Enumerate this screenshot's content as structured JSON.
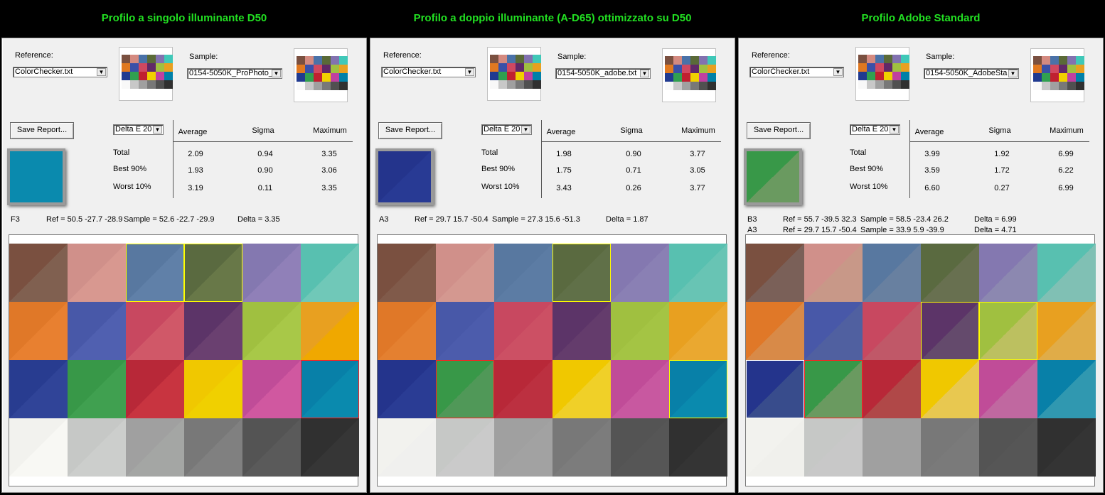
{
  "titles": [
    "Profilo a singolo illuminante D50",
    "Profilo a doppio illuminante (A-D65) ottimizzato su D50",
    "Profilo Adobe Standard"
  ],
  "thumb_colors": [
    "#7a5040",
    "#d48a80",
    "#4a72a8",
    "#5a6a38",
    "#8272b0",
    "#40c8b8",
    "#e07820",
    "#3a50a8",
    "#d04860",
    "#602868",
    "#a0c040",
    "#e8a020",
    "#203a90",
    "#30a050",
    "#c02030",
    "#f0d000",
    "#c040a0",
    "#0080a8",
    "#f8f8f8",
    "#c8c8c8",
    "#a0a0a0",
    "#787878",
    "#505050",
    "#303030"
  ],
  "panels": [
    {
      "reference_label": "Reference:",
      "reference_value": "ColorChecker.txt",
      "sample_label": "Sample:",
      "sample_value": "0154-5050K_ProPhoto_",
      "save_button": "Save Report...",
      "metric_value": "Delta E 20",
      "headers": {
        "average": "Average",
        "sigma": "Sigma",
        "maximum": "Maximum"
      },
      "rows": [
        {
          "label": "Total",
          "average": "2.09",
          "sigma": "0.94",
          "maximum": "3.35"
        },
        {
          "label": "Best 90%",
          "average": "1.93",
          "sigma": "0.90",
          "maximum": "3.06"
        },
        {
          "label": "Worst 10%",
          "average": "3.19",
          "sigma": "0.11",
          "maximum": "3.35"
        }
      ],
      "swatch_colors": [
        "#0a8aae",
        "#0a8aae"
      ],
      "details": [
        {
          "patch": "F3",
          "ref": "Ref =  50.5 -27.7 -28.9",
          "sample": "Sample =  52.6 -22.7 -29.9",
          "delta": "Delta =  3.35"
        }
      ],
      "cells": [
        {
          "ref": "#7a5040",
          "smp": "#806050",
          "mark": ""
        },
        {
          "ref": "#d0908a",
          "smp": "#d89890",
          "mark": ""
        },
        {
          "ref": "#5878a0",
          "smp": "#6080a8",
          "mark": "y"
        },
        {
          "ref": "#5a6a40",
          "smp": "#687848",
          "mark": "y"
        },
        {
          "ref": "#8478b0",
          "smp": "#9080b8",
          "mark": ""
        },
        {
          "ref": "#58c0b0",
          "smp": "#70c8b8",
          "mark": ""
        },
        {
          "ref": "#e07828",
          "smp": "#e88030",
          "mark": ""
        },
        {
          "ref": "#4858a8",
          "smp": "#5060b0",
          "mark": ""
        },
        {
          "ref": "#c84860",
          "smp": "#d05868",
          "mark": ""
        },
        {
          "ref": "#5c3468",
          "smp": "#6a4070",
          "mark": ""
        },
        {
          "ref": "#a0c040",
          "smp": "#a8c848",
          "mark": ""
        },
        {
          "ref": "#e8a020",
          "smp": "#f0a800",
          "mark": ""
        },
        {
          "ref": "#283c90",
          "smp": "#304498",
          "mark": ""
        },
        {
          "ref": "#389848",
          "smp": "#40a050",
          "mark": ""
        },
        {
          "ref": "#b82838",
          "smp": "#c83440",
          "mark": ""
        },
        {
          "ref": "#f0c800",
          "smp": "#f0d000",
          "mark": ""
        },
        {
          "ref": "#c04c98",
          "smp": "#d058a0",
          "mark": ""
        },
        {
          "ref": "#0880a8",
          "smp": "#0a8aae",
          "mark": "r"
        },
        {
          "ref": "#f2f2ee",
          "smp": "#f8f8f4",
          "mark": ""
        },
        {
          "ref": "#c6c8c6",
          "smp": "#cccecc",
          "mark": ""
        },
        {
          "ref": "#a0a0a0",
          "smp": "#a4a6a4",
          "mark": ""
        },
        {
          "ref": "#787878",
          "smp": "#808080",
          "mark": ""
        },
        {
          "ref": "#545454",
          "smp": "#5a5a5a",
          "mark": ""
        },
        {
          "ref": "#303030",
          "smp": "#363636",
          "mark": ""
        }
      ]
    },
    {
      "reference_label": "Reference:",
      "reference_value": "ColorChecker.txt",
      "sample_label": "Sample:",
      "sample_value": "0154-5050K_adobe.txt",
      "save_button": "Save Report...",
      "metric_value": "Delta E 20",
      "headers": {
        "average": "Average",
        "sigma": "Sigma",
        "maximum": "Maximum"
      },
      "rows": [
        {
          "label": "Total",
          "average": "1.98",
          "sigma": "0.90",
          "maximum": "3.77"
        },
        {
          "label": "Best 90%",
          "average": "1.75",
          "sigma": "0.71",
          "maximum": "3.05"
        },
        {
          "label": "Worst 10%",
          "average": "3.43",
          "sigma": "0.26",
          "maximum": "3.77"
        }
      ],
      "swatch_colors": [
        "#24348c",
        "#283a94"
      ],
      "details": [
        {
          "patch": "A3",
          "ref": "Ref =  29.7  15.7 -50.4",
          "sample": "Sample =  27.3  15.6 -51.3",
          "delta": "Delta =  1.87"
        }
      ],
      "cells": [
        {
          "ref": "#7a5040",
          "smp": "#805a4a",
          "mark": ""
        },
        {
          "ref": "#d0908a",
          "smp": "#d49890",
          "mark": ""
        },
        {
          "ref": "#5878a0",
          "smp": "#5c7ca4",
          "mark": ""
        },
        {
          "ref": "#5a6a40",
          "smp": "#607048",
          "mark": "y"
        },
        {
          "ref": "#8478b0",
          "smp": "#8a80b4",
          "mark": ""
        },
        {
          "ref": "#58c0b0",
          "smp": "#68c4b4",
          "mark": ""
        },
        {
          "ref": "#e07828",
          "smp": "#e48030",
          "mark": ""
        },
        {
          "ref": "#4858a8",
          "smp": "#4c5cac",
          "mark": ""
        },
        {
          "ref": "#c84860",
          "smp": "#cc5064",
          "mark": ""
        },
        {
          "ref": "#5c3468",
          "smp": "#643c6c",
          "mark": ""
        },
        {
          "ref": "#a0c040",
          "smp": "#a4c444",
          "mark": ""
        },
        {
          "ref": "#e8a020",
          "smp": "#eaa830",
          "mark": ""
        },
        {
          "ref": "#24348c",
          "smp": "#2a3c94",
          "mark": ""
        },
        {
          "ref": "#389848",
          "smp": "#509858",
          "mark": "r"
        },
        {
          "ref": "#b82838",
          "smp": "#bc3040",
          "mark": ""
        },
        {
          "ref": "#f0c800",
          "smp": "#f0d028",
          "mark": ""
        },
        {
          "ref": "#c04c98",
          "smp": "#c858a0",
          "mark": ""
        },
        {
          "ref": "#0880a8",
          "smp": "#0a8aae",
          "mark": "y"
        },
        {
          "ref": "#f2f2ee",
          "smp": "#f0f0ee",
          "mark": ""
        },
        {
          "ref": "#c6c8c6",
          "smp": "#cacaca",
          "mark": ""
        },
        {
          "ref": "#a0a0a0",
          "smp": "#a2a2a2",
          "mark": ""
        },
        {
          "ref": "#787878",
          "smp": "#7c7c7c",
          "mark": ""
        },
        {
          "ref": "#545454",
          "smp": "#565656",
          "mark": ""
        },
        {
          "ref": "#303030",
          "smp": "#343434",
          "mark": ""
        }
      ]
    },
    {
      "reference_label": "Reference:",
      "reference_value": "ColorChecker.txt",
      "sample_label": "Sample:",
      "sample_value": "0154-5050K_AdobeSta",
      "save_button": "Save Report...",
      "metric_value": "Delta E 20",
      "headers": {
        "average": "Average",
        "sigma": "Sigma",
        "maximum": "Maximum"
      },
      "rows": [
        {
          "label": "Total",
          "average": "3.99",
          "sigma": "1.92",
          "maximum": "6.99"
        },
        {
          "label": "Best 90%",
          "average": "3.59",
          "sigma": "1.72",
          "maximum": "6.22"
        },
        {
          "label": "Worst 10%",
          "average": "6.60",
          "sigma": "0.27",
          "maximum": "6.99"
        }
      ],
      "swatch_colors": [
        "#389848",
        "#6a9a60"
      ],
      "details": [
        {
          "patch": "B3",
          "ref": "Ref =  55.7 -39.5  32.3",
          "sample": "Sample =  58.5 -23.4  26.2",
          "delta": "Delta =  6.99"
        },
        {
          "patch": "A3",
          "ref": "Ref =  29.7  15.7 -50.4",
          "sample": "Sample =  33.9   5.9 -39.9",
          "delta": "Delta =  4.71"
        }
      ],
      "cells": [
        {
          "ref": "#7a5040",
          "smp": "#7a6058",
          "mark": ""
        },
        {
          "ref": "#d0908a",
          "smp": "#c89888",
          "mark": ""
        },
        {
          "ref": "#5878a0",
          "smp": "#6880a0",
          "mark": ""
        },
        {
          "ref": "#5a6a40",
          "smp": "#687050",
          "mark": ""
        },
        {
          "ref": "#8478b0",
          "smp": "#8c88b0",
          "mark": ""
        },
        {
          "ref": "#58c0b0",
          "smp": "#80c0b4",
          "mark": ""
        },
        {
          "ref": "#e07828",
          "smp": "#d88a48",
          "mark": ""
        },
        {
          "ref": "#4858a8",
          "smp": "#5060a0",
          "mark": ""
        },
        {
          "ref": "#c84860",
          "smp": "#c05868",
          "mark": ""
        },
        {
          "ref": "#5c3468",
          "smp": "#644a6c",
          "mark": "y"
        },
        {
          "ref": "#a0c040",
          "smp": "#bcc060",
          "mark": "y"
        },
        {
          "ref": "#e8a020",
          "smp": "#e0ac48",
          "mark": ""
        },
        {
          "ref": "#24348c",
          "smp": "#384c8c",
          "mark": "w"
        },
        {
          "ref": "#389848",
          "smp": "#6a9a60",
          "mark": "r"
        },
        {
          "ref": "#b82838",
          "smp": "#b04848",
          "mark": ""
        },
        {
          "ref": "#f0c800",
          "smp": "#e8c850",
          "mark": ""
        },
        {
          "ref": "#c04c98",
          "smp": "#c068a0",
          "mark": ""
        },
        {
          "ref": "#0880a8",
          "smp": "#3098b0",
          "mark": ""
        },
        {
          "ref": "#f2f2ee",
          "smp": "#f0f0ec",
          "mark": ""
        },
        {
          "ref": "#c6c8c6",
          "smp": "#c8c8c8",
          "mark": ""
        },
        {
          "ref": "#a0a0a0",
          "smp": "#a0a0a0",
          "mark": ""
        },
        {
          "ref": "#787878",
          "smp": "#7a7a7a",
          "mark": ""
        },
        {
          "ref": "#545454",
          "smp": "#565656",
          "mark": ""
        },
        {
          "ref": "#303030",
          "smp": "#343434",
          "mark": ""
        }
      ]
    }
  ]
}
